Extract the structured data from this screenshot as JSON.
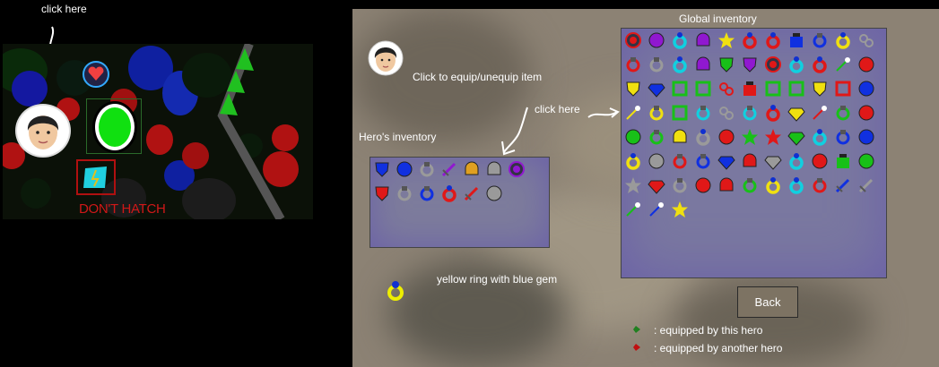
{
  "left": {
    "hint_top": "click here",
    "hatch_label": "DON'T HATCH"
  },
  "menu": {
    "global_title": "Global inventory",
    "hint_equip": "Click to equip/unequip item",
    "hint_click": "click here",
    "hero_inventory_title": "Hero's inventory",
    "selected_item_name": "yellow ring with blue gem",
    "back_label": "Back",
    "legend": [
      {
        "label": ": equipped by this hero",
        "color": "#208020"
      },
      {
        "label": ": equipped by another hero",
        "color": "#c01010"
      }
    ]
  },
  "colors": {
    "background": "#000000",
    "panel": "#8c8274",
    "inventory_box": "#7a78a0",
    "hatch_red": "#d01818",
    "egg_green": "#10e010"
  },
  "hero_inventory_items": [
    "blue-shield",
    "blue-orb",
    "gray-amulet",
    "purple-sword",
    "gold-helmet",
    "gray-helmet",
    "purple-gem",
    "red-shield",
    "gray-amulet",
    "blue-amulet",
    "red-ring",
    "red-sword",
    "gray-orb"
  ],
  "global_inventory_items": [
    "red-gem",
    "purple-orb",
    "cyan-ring",
    "purple-helmet",
    "yellow-star",
    "red-ring",
    "red-ring",
    "blue-potion",
    "blue-amulet",
    "yellow-ring",
    "gray-chain",
    "red-amulet",
    "gray-amulet",
    "cyan-ring",
    "purple-helmet",
    "green-shield",
    "purple-shield",
    "red-gem",
    "cyan-ring",
    "red-ring",
    "green-wand",
    "red-orb",
    "yellow-shield",
    "blue-diamond",
    "green-box",
    "green-box",
    "red-chain",
    "red-potion",
    "green-box",
    "green-box",
    "yellow-shield",
    "red-box",
    "blue-orb",
    "yellow-wand",
    "yellow-amulet",
    "green-box",
    "cyan-amulet",
    "gray-chain",
    "cyan-amulet",
    "red-ring",
    "yellow-diamond",
    "red-wand",
    "green-amulet",
    "red-orb",
    "green-orb",
    "green-amulet",
    "yellow-helmet",
    "gray-ring",
    "red-orb",
    "green-star",
    "red-star",
    "green-diamond",
    "cyan-ring",
    "blue-amulet",
    "blue-orb",
    "yellow-ring",
    "gray-orb",
    "red-amulet",
    "blue-amulet",
    "blue-diamond",
    "red-helmet",
    "gray-diamond",
    "cyan-ring",
    "red-orb",
    "green-potion",
    "green-orb",
    "gray-star",
    "red-diamond",
    "gray-amulet",
    "red-orb",
    "red-helmet",
    "green-amulet",
    "yellow-ring",
    "cyan-ring",
    "red-amulet",
    "blue-sword",
    "gray-sword",
    "green-wand",
    "blue-wand",
    "yellow-star"
  ]
}
